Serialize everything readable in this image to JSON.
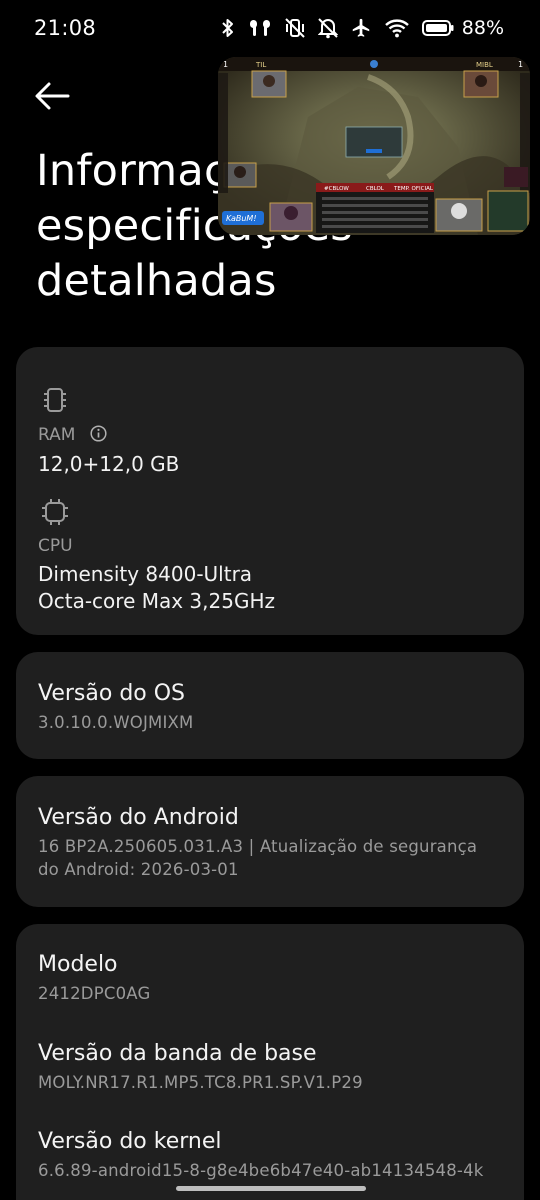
{
  "status_bar": {
    "time": "21:08",
    "battery_percent": "88%",
    "icons": [
      "bluetooth-icon",
      "earbuds-icon",
      "vibrate-icon",
      "mute-icon",
      "airplane-icon",
      "wifi-icon",
      "battery-icon"
    ]
  },
  "header": {
    "title_lines": [
      "Informações e",
      "especificações",
      "detalhadas"
    ]
  },
  "specs": {
    "ram": {
      "label": "RAM",
      "value": "12,0+12,0 GB"
    },
    "cpu": {
      "label": "CPU",
      "value_line1": "Dimensity 8400-Ultra",
      "value_line2": "Octa-core Max 3,25GHz"
    }
  },
  "os_version": {
    "title": "Versão do OS",
    "value": "3.0.10.0.WOJMIXM"
  },
  "android_version": {
    "title": "Versão do Android",
    "value_line1": "16 BP2A.250605.031.A3 | Atualização de segurança",
    "value_line2": "do Android: 2026-03-01"
  },
  "model": {
    "title": "Modelo",
    "value": "2412DPC0AG"
  },
  "baseband": {
    "title": "Versão da banda de base",
    "value": "MOLY.NR17.R1.MP5.TC8.PR1.SP.V1.P29"
  },
  "kernel": {
    "title": "Versão do kernel",
    "value": "6.6.89-android15-8-g8e4be6b47e40-ab14134548-4k"
  },
  "pip_video": {
    "team_left": "TIL",
    "team_right": "MIBL",
    "score_left": "1",
    "score_right": "1",
    "bar_left": "#CBLOW",
    "bar_center": "CBLOL",
    "bar_right": "TEMP. OFICIAL",
    "sponsor": "KaBuM!",
    "colors": {
      "gold": "#c8a04a",
      "red": "#8a1a1a",
      "blue": "#1f6fd6"
    }
  }
}
